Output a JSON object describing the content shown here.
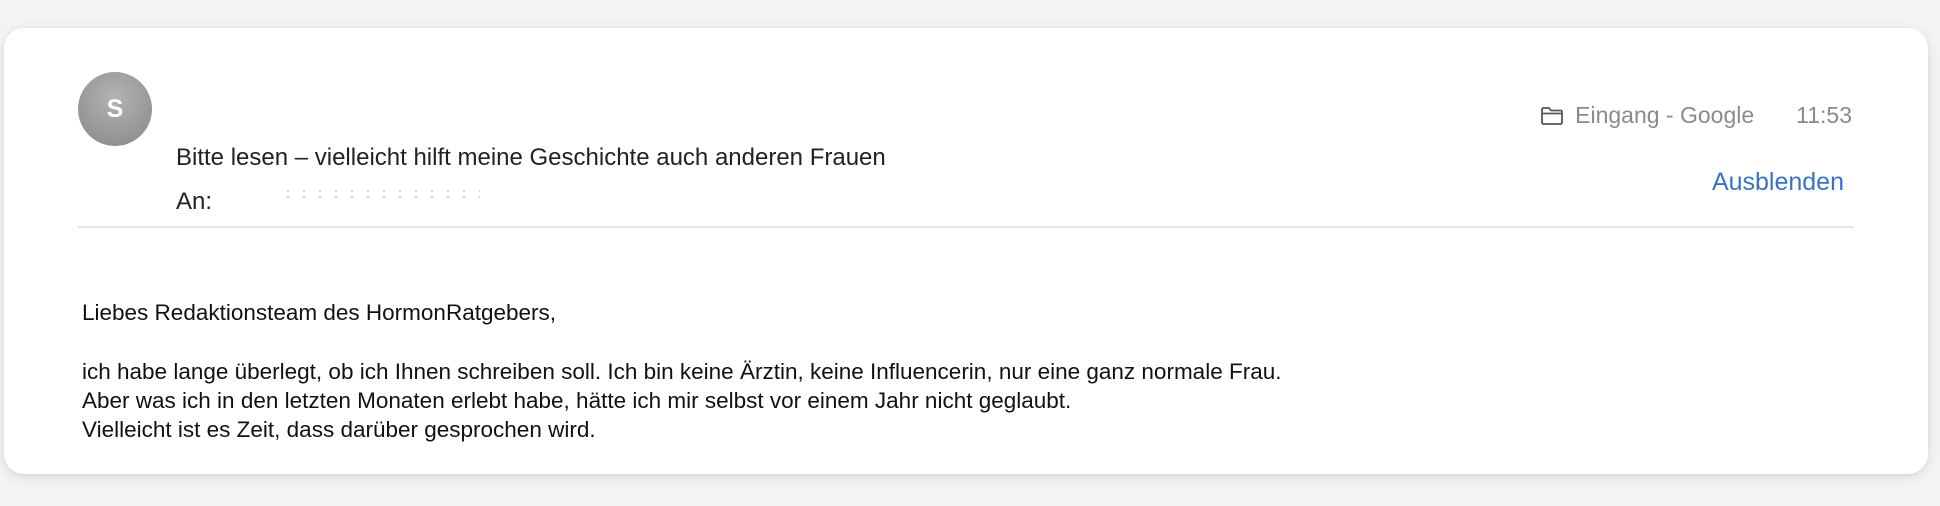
{
  "email": {
    "sender_initial": "S",
    "subject": "Bitte lesen – vielleicht hilft meine Geschichte auch anderen Frauen",
    "to_label": "An:",
    "folder": "Eingang - Google",
    "time": "11:53",
    "hide_label": "Ausblenden",
    "greeting": "Liebes Redaktionsteam des HormonRatgebers,",
    "paragraph_lines": [
      "ich habe lange überlegt, ob ich Ihnen schreiben soll. Ich bin keine Ärztin, keine Influencerin, nur eine ganz normale Frau.",
      "Aber was ich in den letzten Monaten erlebt habe, hätte ich mir selbst vor einem Jahr nicht geglaubt.",
      "Vielleicht ist es Zeit, dass darüber gesprochen wird."
    ]
  },
  "icons": {
    "folder": "folder-icon"
  },
  "colors": {
    "background": "#f4f4f5",
    "card": "#ffffff",
    "avatar": "#9c9c9f",
    "link": "#3d72c3",
    "meta_text": "#8a8a8e",
    "body_text": "#111111"
  }
}
